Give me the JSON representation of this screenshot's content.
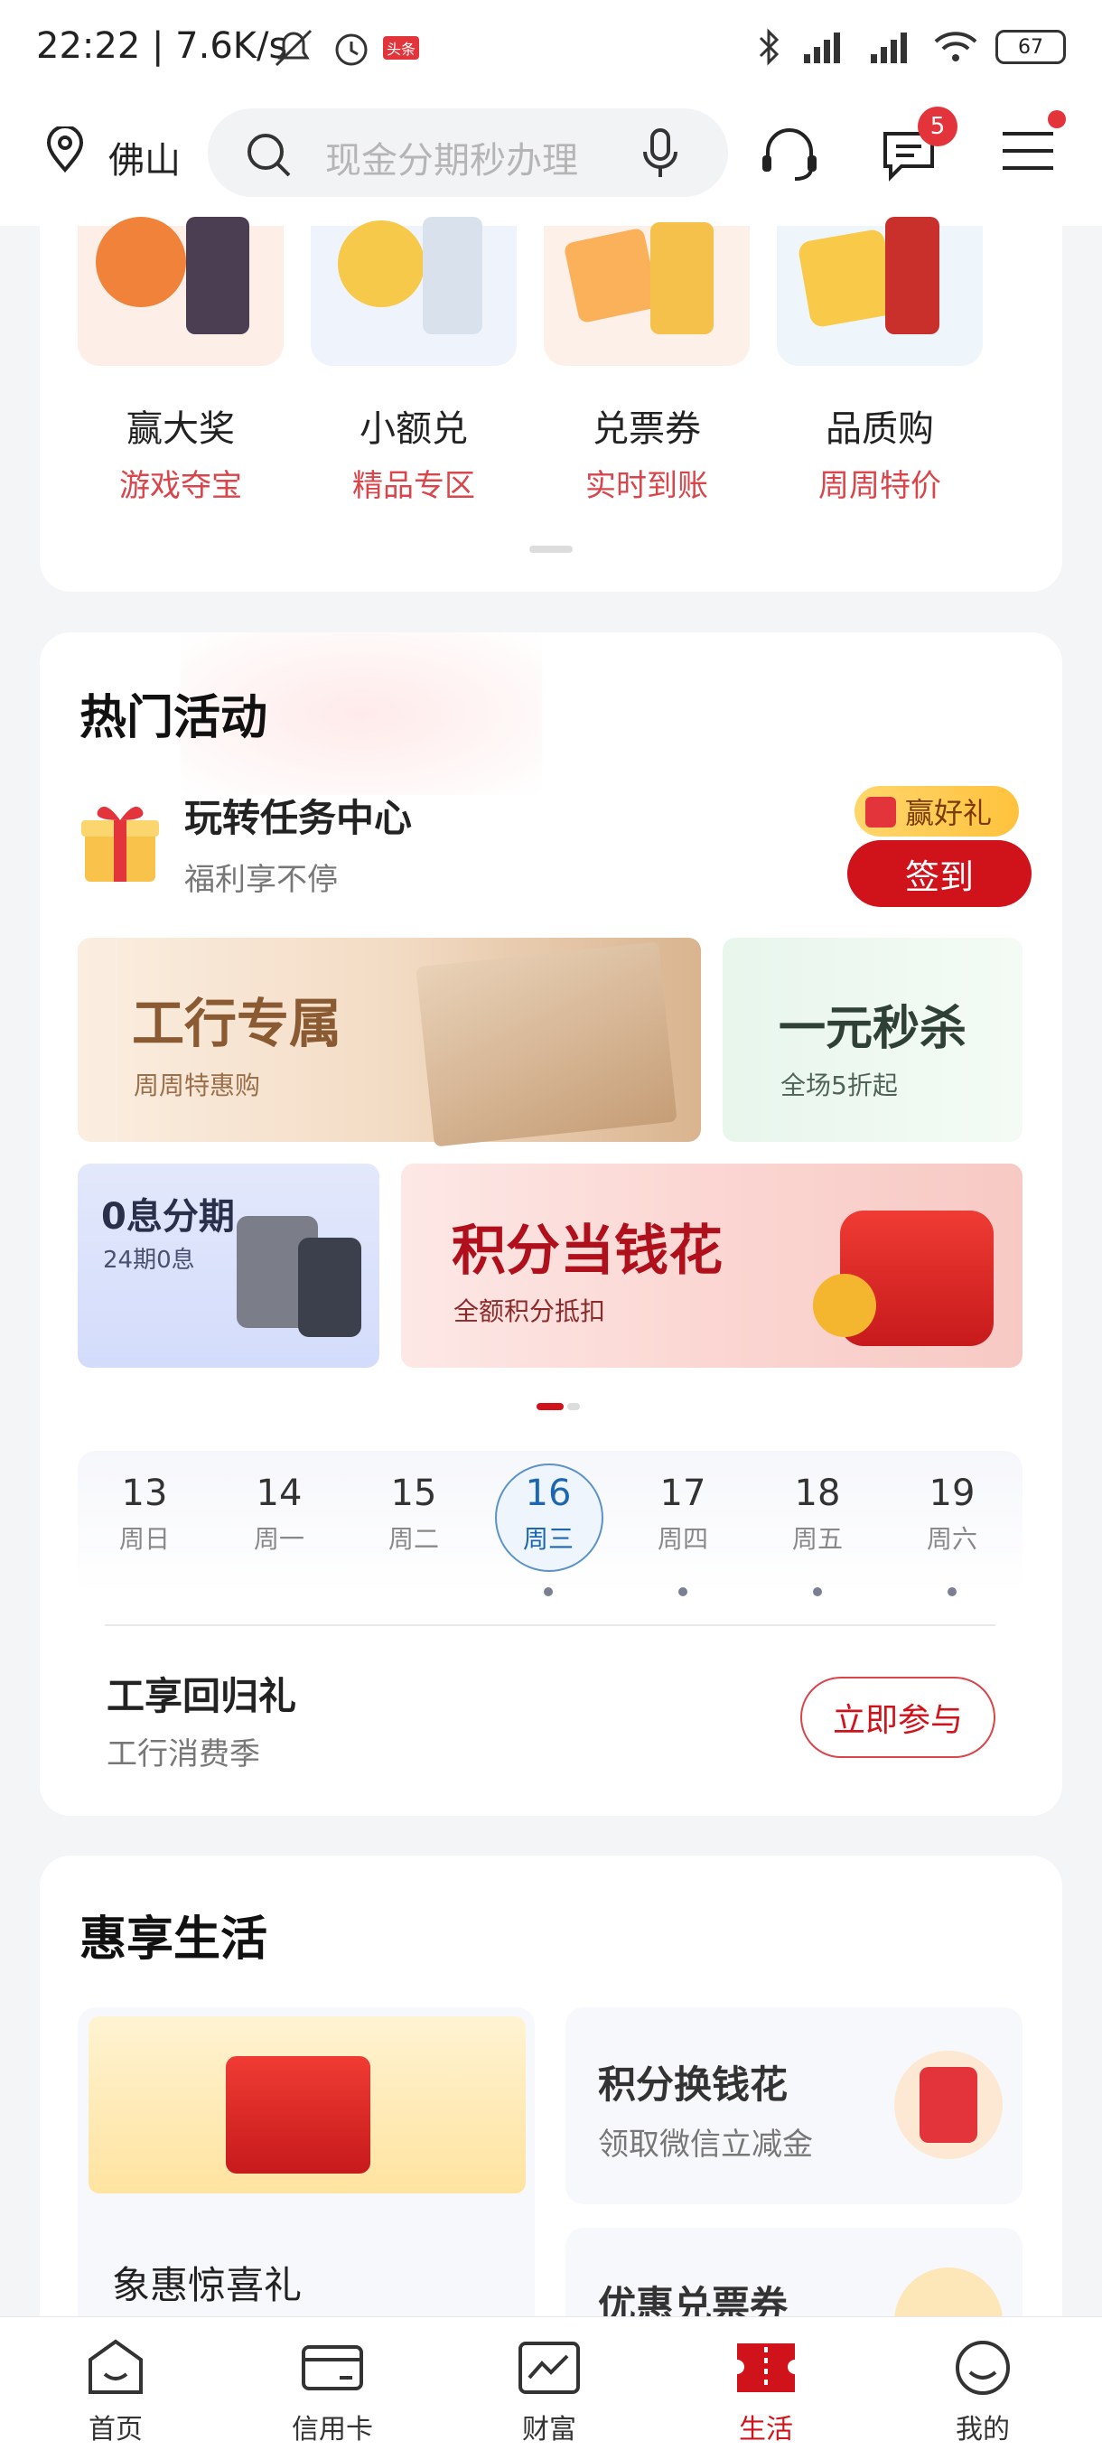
{
  "status_bar": {
    "time_speed": "22:22 | 7.6K/s",
    "battery": "67",
    "news_tag": "头条"
  },
  "header": {
    "city": "佛山",
    "search_placeholder": "现金分期秒办理",
    "message_badge": "5"
  },
  "quick_tiles": [
    {
      "label": "赢大奖",
      "sub": "游戏夺宝",
      "bg": "#fdeee8"
    },
    {
      "label": "小额兑",
      "sub": "精品专区",
      "bg": "#eef3fc"
    },
    {
      "label": "兑票券",
      "sub": "实时到账",
      "bg": "#fdf0e8"
    },
    {
      "label": "品质购",
      "sub": "周周特价",
      "bg": "#eef5fb"
    }
  ],
  "hot": {
    "title": "热门活动",
    "task_title": "玩转任务中心",
    "task_sub": "福利享不停",
    "win_tag": "赢好礼",
    "sign_button": "签到",
    "banners": {
      "exclusive_title": "工行专属",
      "exclusive_sub": "周周特惠购",
      "flash_title": "一元秒杀",
      "flash_sub": "全场5折起",
      "zero_title": "0息分期",
      "zero_sub": "24期0息",
      "points_title": "积分当钱花",
      "points_sub": "全额积分抵扣"
    },
    "calendar": [
      {
        "num": "13",
        "wk": "周日"
      },
      {
        "num": "14",
        "wk": "周一"
      },
      {
        "num": "15",
        "wk": "周二"
      },
      {
        "num": "16",
        "wk": "周三"
      },
      {
        "num": "17",
        "wk": "周四"
      },
      {
        "num": "18",
        "wk": "周五"
      },
      {
        "num": "19",
        "wk": "周六"
      }
    ],
    "event_title": "工享回归礼",
    "event_sub": "工行消费季",
    "join_button": "立即参与"
  },
  "life": {
    "title": "惠享生活",
    "left_title": "象惠惊喜礼",
    "r1_title": "积分换钱花",
    "r1_sub": "领取微信立减金",
    "r2_title": "优惠兑票券"
  },
  "tabs": [
    {
      "label": "首页"
    },
    {
      "label": "信用卡"
    },
    {
      "label": "财富"
    },
    {
      "label": "生活"
    },
    {
      "label": "我的"
    }
  ],
  "colors": {
    "brand_red": "#d0121b",
    "accent_blue": "#1d67b0"
  }
}
